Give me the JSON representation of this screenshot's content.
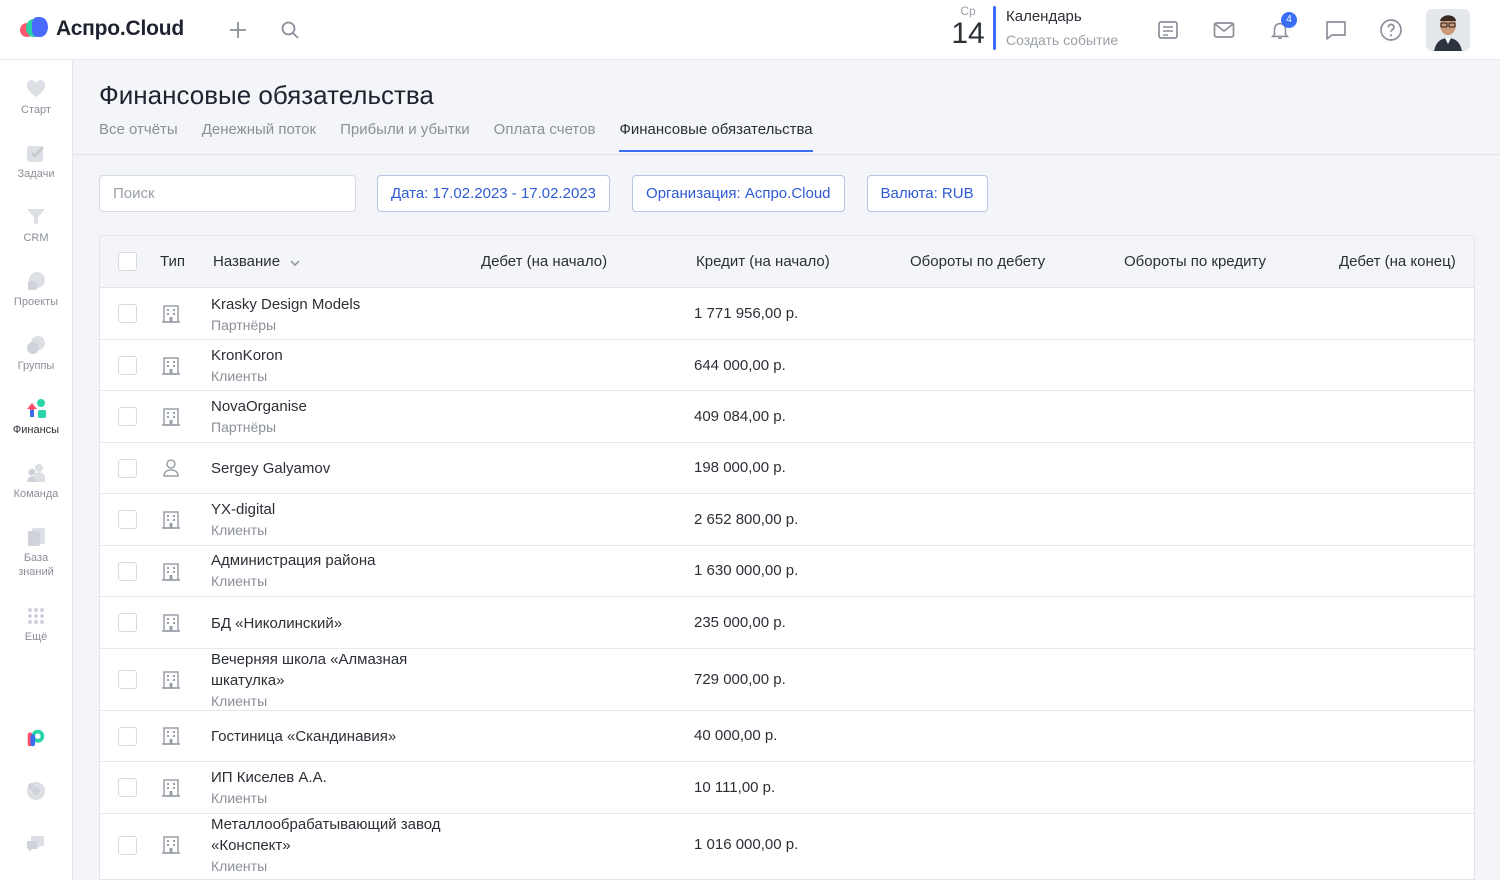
{
  "app": {
    "logo_text": "Аспро.Cloud"
  },
  "topbar": {
    "date_dow": "Ср",
    "date_day": "14",
    "calendar_title": "Календарь",
    "calendar_sub": "Создать событие",
    "notifications_count": "4"
  },
  "sidebar": {
    "items": [
      {
        "label": "Старт",
        "icon": "heart-icon"
      },
      {
        "label": "Задачи",
        "icon": "check-icon"
      },
      {
        "label": "CRM",
        "icon": "funnel-icon"
      },
      {
        "label": "Проекты",
        "icon": "projects-icon"
      },
      {
        "label": "Группы",
        "icon": "groups-icon"
      },
      {
        "label": "Финансы",
        "icon": "finance-icon"
      },
      {
        "label": "Команда",
        "icon": "team-icon"
      },
      {
        "label": "База знаний",
        "icon": "book-icon"
      },
      {
        "label": "Ещё",
        "icon": "grid-icon"
      }
    ]
  },
  "page": {
    "title": "Финансовые обязательства",
    "tabs": [
      {
        "label": "Все отчёты",
        "active": false
      },
      {
        "label": "Денежный поток",
        "active": false
      },
      {
        "label": "Прибыли и убытки",
        "active": false
      },
      {
        "label": "Оплата счетов",
        "active": false
      },
      {
        "label": "Финансовые обязательства",
        "active": true
      }
    ]
  },
  "filters": {
    "search_placeholder": "Поиск",
    "date": "Дата: 17.02.2023 - 17.02.2023",
    "organization": "Организация: Аспро.Cloud",
    "currency": "Валюта: RUB"
  },
  "table": {
    "columns": [
      "Тип",
      "Название",
      "Дебет (на начало)",
      "Кредит (на начало)",
      "Обороты по дебету",
      "Обороты по кредиту",
      "Дебет (на конец)"
    ],
    "rows": [
      {
        "type": "company",
        "name": "Krasky Design Models",
        "group": "Партнёры",
        "credit": "1 771 956,00 р."
      },
      {
        "type": "company",
        "name": "KronKoron",
        "group": "Клиенты",
        "credit": "644 000,00 р."
      },
      {
        "type": "company",
        "name": "NovaOrganise",
        "group": "Партнёры",
        "credit": "409 084,00 р."
      },
      {
        "type": "person",
        "name": "Sergey Galyamov",
        "group": "",
        "credit": "198 000,00 р."
      },
      {
        "type": "company",
        "name": "YX-digital",
        "group": "Клиенты",
        "credit": "2 652 800,00 р."
      },
      {
        "type": "company",
        "name": "Администрация района",
        "group": "Клиенты",
        "credit": "1 630 000,00 р."
      },
      {
        "type": "company",
        "name": "БД «Николинский»",
        "group": "",
        "credit": "235 000,00 р."
      },
      {
        "type": "company",
        "name": "Вечерняя школа «Алмазная шкатулка»",
        "group": "Клиенты",
        "credit": "729 000,00 р."
      },
      {
        "type": "company",
        "name": "Гостиница «Скандинавия»",
        "group": "",
        "credit": "40 000,00 р."
      },
      {
        "type": "company",
        "name": "ИП Киселев А.А.",
        "group": "Клиенты",
        "credit": "10 111,00 р."
      },
      {
        "type": "company",
        "name": "Металлообрабатывающий завод «Конспект»",
        "group": "Клиенты",
        "credit": "1 016 000,00 р."
      }
    ]
  },
  "colors": {
    "accent": "#3b6ef5",
    "chip_text": "#2f5bd4"
  }
}
